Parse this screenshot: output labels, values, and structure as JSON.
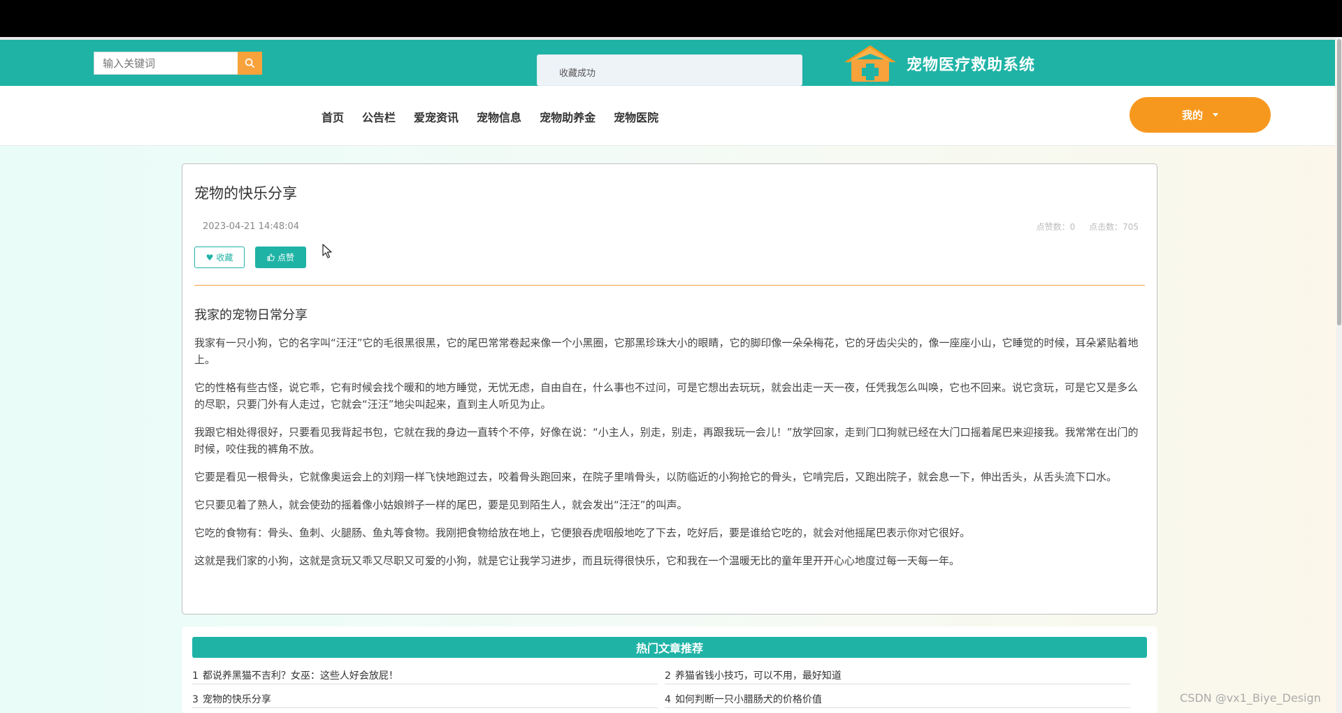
{
  "search": {
    "placeholder": "输入关键词"
  },
  "toast": {
    "message": "收藏成功"
  },
  "brand": {
    "title": "宠物医疗救助系统"
  },
  "nav": {
    "items": [
      "首页",
      "公告栏",
      "爱宠资讯",
      "宠物信息",
      "宠物助养金",
      "宠物医院"
    ]
  },
  "user_menu": {
    "label": "我的"
  },
  "article": {
    "title": "宠物的快乐分享",
    "date": "2023-04-21 14:48:04",
    "likes_label": "点赞数：0",
    "clicks_label": "点击数：705",
    "fav_button": "收藏",
    "like_button": "点赞",
    "heading": "我家的宠物日常分享",
    "paragraphs": [
      "我家有一只小狗，它的名字叫“汪汪”它的毛很黑很黑，它的尾巴常常卷起来像一个小黑圈，它那黑珍珠大小的眼睛，它的脚印像一朵朵梅花，它的牙齿尖尖的，像一座座小山，它睡觉的时候，耳朵紧贴着地上。",
      "它的性格有些古怪，说它乖，它有时候会找个暖和的地方睡觉，无忧无虑，自由自在，什么事也不过问，可是它想出去玩玩，就会出走一天一夜，任凭我怎么叫唤，它也不回来。说它贪玩，可是它又是多么的尽职，只要门外有人走过，它就会“汪汪”地尖叫起来，直到主人听见为止。",
      "我跟它相处得很好，只要看见我背起书包，它就在我的身边一直转个不停，好像在说：“小主人，别走，别走，再跟我玩一会儿！”放学回家，走到门口狗就已经在大门口摇着尾巴来迎接我。我常常在出门的时候，咬住我的裤角不放。",
      "它要是看见一根骨头，它就像奥运会上的刘翔一样飞快地跑过去，咬着骨头跑回来，在院子里啃骨头，以防临近的小狗抢它的骨头，它啃完后，又跑出院子，就会息一下，伸出舌头，从舌头流下口水。",
      "它只要见着了熟人，就会使劲的摇着像小姑娘辫子一样的尾巴，要是见到陌生人，就会发出“汪汪”的叫声。",
      "它吃的食物有：骨头、鱼刺、火腿肠、鱼丸等食物。我刚把食物给放在地上，它便狼吞虎咽般地吃了下去，吃好后，要是谁给它吃的，就会对他摇尾巴表示你对它很好。",
      "这就是我们家的小狗，这就是贪玩又乖又尽职又可爱的小狗，就是它让我学习进步，而且玩得很快乐，它和我在一个温暖无比的童年里开开心心地度过每一天每一年。"
    ]
  },
  "hot": {
    "title": "热门文章推荐",
    "items": [
      {
        "num": "1",
        "title": "都说养黑猫不吉利？女巫：这些人好会放屁！"
      },
      {
        "num": "2",
        "title": "养猫省钱小技巧，可以不用，最好知道"
      },
      {
        "num": "3",
        "title": "宠物的快乐分享"
      },
      {
        "num": "4",
        "title": "如何判断一只小腊肠犬的价格价值"
      }
    ]
  },
  "watermark": "CSDN @vx1_Biye_Design",
  "colors": {
    "teal": "#1fb3a6",
    "orange": "#f7981e",
    "divider": "#f1a23c"
  },
  "icons": [
    "search-icon",
    "house-plus-logo-icon",
    "heart-icon",
    "thumbs-up-icon",
    "mouse-cursor-icon",
    "chevron-down-icon"
  ]
}
